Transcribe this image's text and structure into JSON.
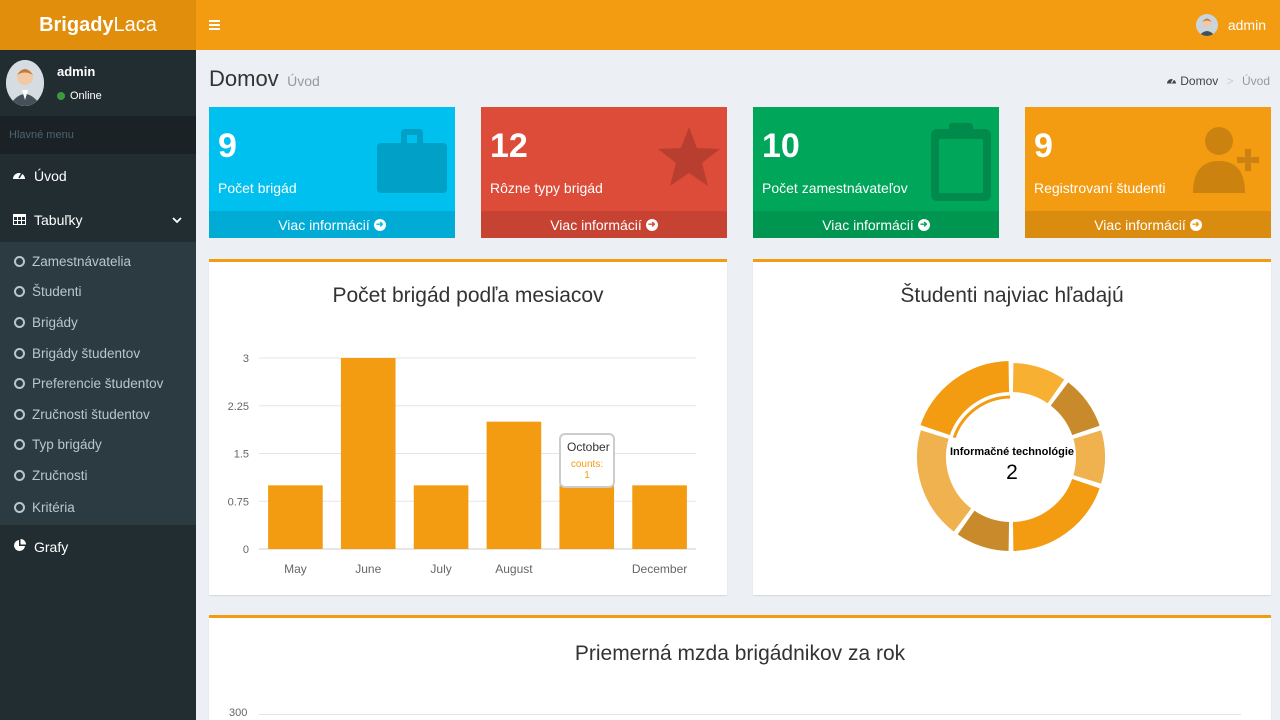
{
  "app": {
    "logo_bold": "Brigady",
    "logo_light": "Laca"
  },
  "navbar": {
    "menu_icon": "hamburger-icon",
    "user_name": "admin"
  },
  "sidebar": {
    "user_name": "admin",
    "status": "Online",
    "menu_header": "Hlavné menu",
    "items": [
      {
        "label": "Úvod",
        "icon": "dashboard-icon"
      },
      {
        "label": "Tabuľky",
        "icon": "table-icon"
      },
      {
        "label": "Grafy",
        "icon": "pie-chart-icon"
      }
    ],
    "subitems": [
      "Zamestnávatelia",
      "Študenti",
      "Brigády",
      "Brigády študentov",
      "Preferencie študentov",
      "Zručnosti študentov",
      "Typ brigády",
      "Zručnosti",
      "Kritéria"
    ]
  },
  "header": {
    "title": "Domov",
    "subtitle": "Úvod",
    "breadcrumb_home": "Domov",
    "breadcrumb_current": "Úvod"
  },
  "boxes": [
    {
      "value": "9",
      "label": "Počet brigád",
      "link": "Viac informácií",
      "color": "#00c0ef",
      "icon": "briefcase-icon"
    },
    {
      "value": "12",
      "label": "Rôzne typy brigád",
      "link": "Viac informácií",
      "color": "#dd4b39",
      "icon": "star-icon"
    },
    {
      "value": "10",
      "label": "Počet zamestnávateľov",
      "link": "Viac informácií",
      "color": "#00a65a",
      "icon": "clipboard-icon"
    },
    {
      "value": "9",
      "label": "Registrovaní študenti",
      "link": "Viac informácií",
      "color": "#f39c12",
      "icon": "user-plus-icon"
    }
  ],
  "chart_data": [
    {
      "type": "bar",
      "title": "Počet brigád podľa mesiacov",
      "categories": [
        "May",
        "June",
        "July",
        "August",
        "October",
        "December"
      ],
      "x_tick_labels": [
        "May",
        "June",
        "July",
        "August",
        "",
        "December"
      ],
      "values": [
        1,
        3,
        1,
        2,
        1,
        1
      ],
      "y_ticks": [
        "0",
        "0.75",
        "1.5",
        "2.25",
        "3"
      ],
      "ylim": [
        0,
        3
      ],
      "grid": true,
      "color": "#f39c12",
      "tooltip": {
        "title": "October",
        "text": "counts: 1"
      }
    },
    {
      "type": "pie",
      "title": "Študenti najviac hľadajú",
      "center_label": "Informačné technológie",
      "center_value": "2",
      "values": [
        1,
        1,
        1,
        2,
        1,
        2,
        2
      ],
      "colors": [
        "#f8b032",
        "#c88a2b",
        "#f0b24e",
        "#f39c12",
        "#c88a2b",
        "#f0b24e",
        "#f39c12"
      ],
      "highlighted_index": 6
    },
    {
      "type": "line",
      "title": "Priemerná mzda brigádnikov za rok",
      "y_ticks": [
        "300"
      ]
    }
  ]
}
